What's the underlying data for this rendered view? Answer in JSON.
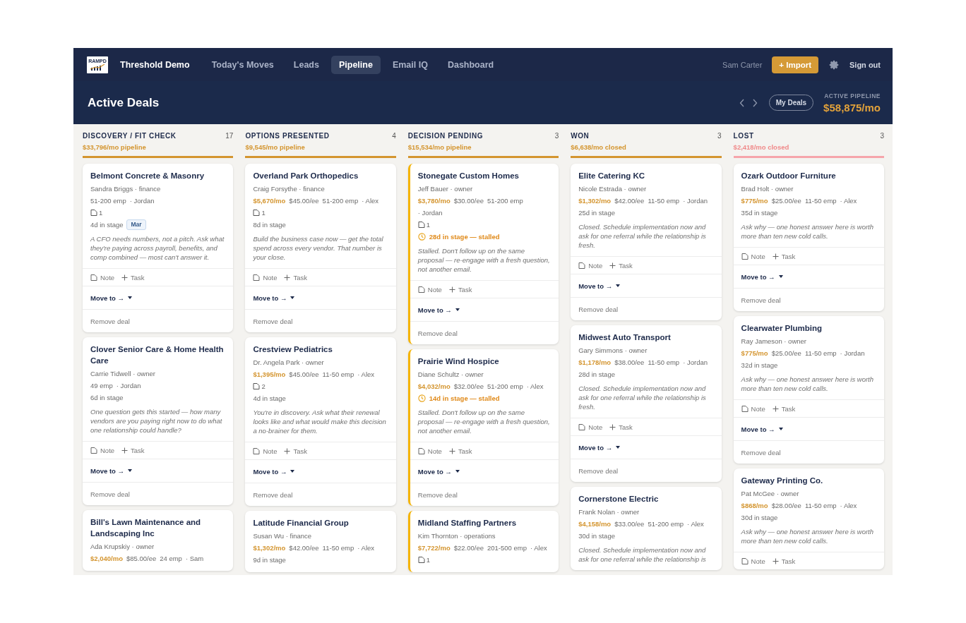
{
  "nav": {
    "logo_text": "RAMPD",
    "title": "Threshold Demo",
    "items": [
      {
        "label": "Today's Moves",
        "selected": false
      },
      {
        "label": "Leads",
        "selected": false
      },
      {
        "label": "Pipeline",
        "selected": true
      },
      {
        "label": "Email IQ",
        "selected": false
      },
      {
        "label": "Dashboard",
        "selected": false
      }
    ],
    "user": "Sam Carter",
    "import_button": "+ Import",
    "sign_out": "Sign out"
  },
  "header": {
    "title": "Active Deals",
    "filter_button": "My Deals",
    "summary_label": "ACTIVE PIPELINE",
    "summary_value": "$58,875/mo"
  },
  "columns": [
    {
      "title": "DISCOVERY / FIT CHECK",
      "count": "17",
      "subtitle": "$33,796/mo pipeline",
      "kind": "open",
      "cards": [
        {
          "name": "Belmont Concrete & Masonry",
          "contact": "Sandra Briggs · finance",
          "emp": "51-200 emp",
          "owner": "· Jordan",
          "docs": "1",
          "days": "4d in stage",
          "stalled": false,
          "tag": "Mar",
          "note": "A CFO needs numbers, not a pitch. Ask what they're paying across payroll, benefits, and comp combined — most can't answer it.",
          "actions": {
            "note": "Note",
            "task": "Task",
            "move": "Move to →",
            "remove": "Remove deal"
          }
        },
        {
          "name": "Clover Senior Care & Home Health Care",
          "contact": "Carrie Tidwell · owner",
          "emp": "49 emp",
          "owner": "· Jordan",
          "days": "6d in stage",
          "stalled": false,
          "note": "One question gets this started — how many vendors are you paying right now to do what one relationship could handle?",
          "actions": {
            "note": "Note",
            "task": "Task",
            "move": "Move to →",
            "remove": "Remove deal"
          }
        },
        {
          "name": "Bill's Lawn Maintenance and Landscaping Inc",
          "contact": "Ada Krupskiy · owner",
          "mrr": "$2,040/mo",
          "rate": "$85.00/ee",
          "emp": "24 emp",
          "owner": "· Sam",
          "stalled": false
        }
      ]
    },
    {
      "title": "OPTIONS PRESENTED",
      "count": "4",
      "subtitle": "$9,545/mo pipeline",
      "kind": "open",
      "cards": [
        {
          "name": "Overland Park Orthopedics",
          "contact": "Craig Forsythe · finance",
          "mrr": "$5,670/mo",
          "rate": "$45.00/ee",
          "emp": "51-200 emp",
          "owner": "· Alex",
          "docs": "1",
          "days": "8d in stage",
          "stalled": false,
          "note": "Build the business case now — get the total spend across every vendor. That number is your close.",
          "actions": {
            "note": "Note",
            "task": "Task",
            "move": "Move to →",
            "remove": "Remove deal"
          }
        },
        {
          "name": "Crestview Pediatrics",
          "contact": "Dr. Angela Park · owner",
          "mrr": "$1,395/mo",
          "rate": "$45.00/ee",
          "emp": "11-50 emp",
          "owner": "· Alex",
          "docs": "2",
          "days": "4d in stage",
          "stalled": false,
          "note": "You're in discovery. Ask what their renewal looks like and what would make this decision a no-brainer for them.",
          "actions": {
            "note": "Note",
            "task": "Task",
            "move": "Move to →",
            "remove": "Remove deal"
          }
        },
        {
          "name": "Latitude Financial Group",
          "contact": "Susan Wu · finance",
          "mrr": "$1,302/mo",
          "rate": "$42.00/ee",
          "emp": "11-50 emp",
          "owner": "· Alex",
          "days": "9d in stage",
          "stalled": false
        }
      ]
    },
    {
      "title": "DECISION PENDING",
      "count": "3",
      "subtitle": "$15,534/mo pipeline",
      "kind": "open",
      "cards": [
        {
          "name": "Stonegate Custom Homes",
          "contact": "Jeff Bauer · owner",
          "mrr": "$3,780/mo",
          "rate": "$30.00/ee",
          "emp": "51-200 emp",
          "owner": "· Jordan",
          "docs": "1",
          "days": "28d in stage — stalled",
          "stalled": true,
          "note": "Stalled. Don't follow up on the same proposal — re-engage with a fresh question, not another email.",
          "actions": {
            "note": "Note",
            "task": "Task",
            "move": "Move to →",
            "remove": "Remove deal"
          }
        },
        {
          "name": "Prairie Wind Hospice",
          "contact": "Diane Schultz · owner",
          "mrr": "$4,032/mo",
          "rate": "$32.00/ee",
          "emp": "51-200 emp",
          "owner": "· Alex",
          "days": "14d in stage — stalled",
          "stalled": true,
          "note": "Stalled. Don't follow up on the same proposal — re-engage with a fresh question, not another email.",
          "actions": {
            "note": "Note",
            "task": "Task",
            "move": "Move to →",
            "remove": "Remove deal"
          }
        },
        {
          "name": "Midland Staffing Partners",
          "contact": "Kim Thornton · operations",
          "mrr": "$7,722/mo",
          "rate": "$22.00/ee",
          "emp": "201-500 emp",
          "owner": "· Alex",
          "docs": "1",
          "stalled": true
        }
      ]
    },
    {
      "title": "WON",
      "count": "3",
      "subtitle": "$6,638/mo closed",
      "kind": "open",
      "cards": [
        {
          "name": "Elite Catering KC",
          "contact": "Nicole Estrada · owner",
          "mrr": "$1,302/mo",
          "rate": "$42.00/ee",
          "emp": "11-50 emp",
          "owner": "· Jordan",
          "days": "25d in stage",
          "stalled": false,
          "note": "Closed. Schedule implementation now and ask for one referral while the relationship is fresh.",
          "actions": {
            "note": "Note",
            "task": "Task",
            "move": "Move to →",
            "remove": "Remove deal"
          }
        },
        {
          "name": "Midwest Auto Transport",
          "contact": "Gary Simmons · owner",
          "mrr": "$1,178/mo",
          "rate": "$38.00/ee",
          "emp": "11-50 emp",
          "owner": "· Jordan",
          "days": "28d in stage",
          "stalled": false,
          "note": "Closed. Schedule implementation now and ask for one referral while the relationship is fresh.",
          "actions": {
            "note": "Note",
            "task": "Task",
            "move": "Move to →",
            "remove": "Remove deal"
          }
        },
        {
          "name": "Cornerstone Electric",
          "contact": "Frank Nolan · owner",
          "mrr": "$4,158/mo",
          "rate": "$33.00/ee",
          "emp": "51-200 emp",
          "owner": "· Alex",
          "days": "30d in stage",
          "stalled": false,
          "note": "Closed. Schedule implementation now and ask for one referral while the relationship is"
        }
      ]
    },
    {
      "title": "LOST",
      "count": "3",
      "subtitle": "$2,418/mo closed",
      "kind": "lost",
      "cards": [
        {
          "name": "Ozark Outdoor Furniture",
          "contact": "Brad Holt · owner",
          "mrr": "$775/mo",
          "rate": "$25.00/ee",
          "emp": "11-50 emp",
          "owner": "· Alex",
          "days": "35d in stage",
          "stalled": false,
          "note": "Ask why — one honest answer here is worth more than ten new cold calls.",
          "actions": {
            "note": "Note",
            "task": "Task",
            "move": "Move to →",
            "remove": "Remove deal"
          }
        },
        {
          "name": "Clearwater Plumbing",
          "contact": "Ray Jameson · owner",
          "mrr": "$775/mo",
          "rate": "$25.00/ee",
          "emp": "11-50 emp",
          "owner": "· Jordan",
          "days": "32d in stage",
          "stalled": false,
          "note": "Ask why — one honest answer here is worth more than ten new cold calls.",
          "actions": {
            "note": "Note",
            "task": "Task",
            "move": "Move to →",
            "remove": "Remove deal"
          }
        },
        {
          "name": "Gateway Printing Co.",
          "contact": "Pat McGee · owner",
          "mrr": "$868/mo",
          "rate": "$28.00/ee",
          "emp": "11-50 emp",
          "owner": "· Alex",
          "days": "30d in stage",
          "stalled": false,
          "note": "Ask why — one honest answer here is worth more than ten new cold calls.",
          "actions": {
            "note": "Note",
            "task": "Task"
          }
        }
      ]
    }
  ]
}
